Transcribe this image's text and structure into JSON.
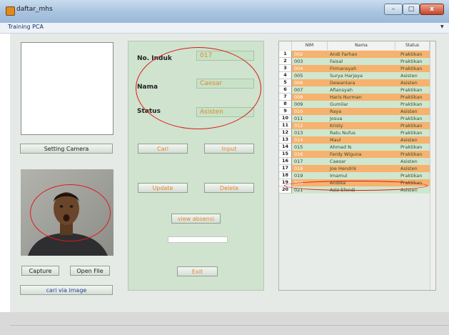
{
  "window": {
    "title": "daftar_mhs",
    "minimize": "–",
    "maximize": "□",
    "close": "x"
  },
  "menu": {
    "title": "Training PCA",
    "arrow": "▼"
  },
  "buttons": {
    "setting_camera": "Setting Camera",
    "capture": "Capture",
    "open_file": "Open File",
    "cari_via_image": "cari via image",
    "cari": "Cari",
    "input": "Input",
    "update": "Update",
    "delete": "Delete",
    "view_absensi": "view absensi",
    "exit": "Exit"
  },
  "form": {
    "no_induk_label": "No. Induk",
    "no_induk_value": "017",
    "nama_label": "Nama",
    "nama_value": "Caesar",
    "status_label": "Status",
    "status_value": "Asisten"
  },
  "table": {
    "headers": [
      "NIM",
      "Nama",
      "Status"
    ],
    "rows": [
      {
        "no": "1",
        "nim": "002",
        "nama": "Andi Farhan",
        "status": "Praktikan"
      },
      {
        "no": "2",
        "nim": "003",
        "nama": "Faisal",
        "status": "Praktikan"
      },
      {
        "no": "3",
        "nim": "004",
        "nama": "Firmansyah",
        "status": "Praktikan"
      },
      {
        "no": "4",
        "nim": "005",
        "nama": "Surya Harjaya",
        "status": "Asisten"
      },
      {
        "no": "5",
        "nim": "006",
        "nama": "Dewantara",
        "status": "Asisten"
      },
      {
        "no": "6",
        "nim": "007",
        "nama": "Afiansyah",
        "status": "Praktikan"
      },
      {
        "no": "7",
        "nim": "008",
        "nama": "Haris Nurman",
        "status": "Praktikan"
      },
      {
        "no": "8",
        "nim": "009",
        "nama": "Gumilar",
        "status": "Praktikan"
      },
      {
        "no": "9",
        "nim": "010",
        "nama": "Raya",
        "status": "Asisten"
      },
      {
        "no": "10",
        "nim": "011",
        "nama": "Josua",
        "status": "Praktikan"
      },
      {
        "no": "11",
        "nim": "012",
        "nama": "Kristy",
        "status": "Praktikan"
      },
      {
        "no": "12",
        "nim": "013",
        "nama": "Ratu Nufus",
        "status": "Praktikan"
      },
      {
        "no": "13",
        "nim": "014",
        "nama": "Maul",
        "status": "Asisten"
      },
      {
        "no": "14",
        "nim": "015",
        "nama": "Ahmad N.",
        "status": "Praktikan"
      },
      {
        "no": "15",
        "nim": "016",
        "nama": "Ferdy Wiguna",
        "status": "Praktikan"
      },
      {
        "no": "16",
        "nim": "017",
        "nama": "Caesar",
        "status": "Asisten"
      },
      {
        "no": "17",
        "nim": "018",
        "nama": "Joe Hendrik",
        "status": "Asisten"
      },
      {
        "no": "18",
        "nim": "019",
        "nama": "Imamul",
        "status": "Praktikan"
      },
      {
        "no": "19",
        "nim": "020",
        "nama": "Andika",
        "status": "Praktikan"
      },
      {
        "no": "20",
        "nim": "021",
        "nama": "Aziz Efendi",
        "status": "Asisten"
      }
    ]
  },
  "colors": {
    "row_orange": "#f6b26e",
    "row_green": "#cfe6cf",
    "text_orange": "#e3872f",
    "annotation_red": "#e01818",
    "form_panel": "#cfe3cf"
  },
  "icons": {
    "app": "matlab-figure-icon"
  }
}
